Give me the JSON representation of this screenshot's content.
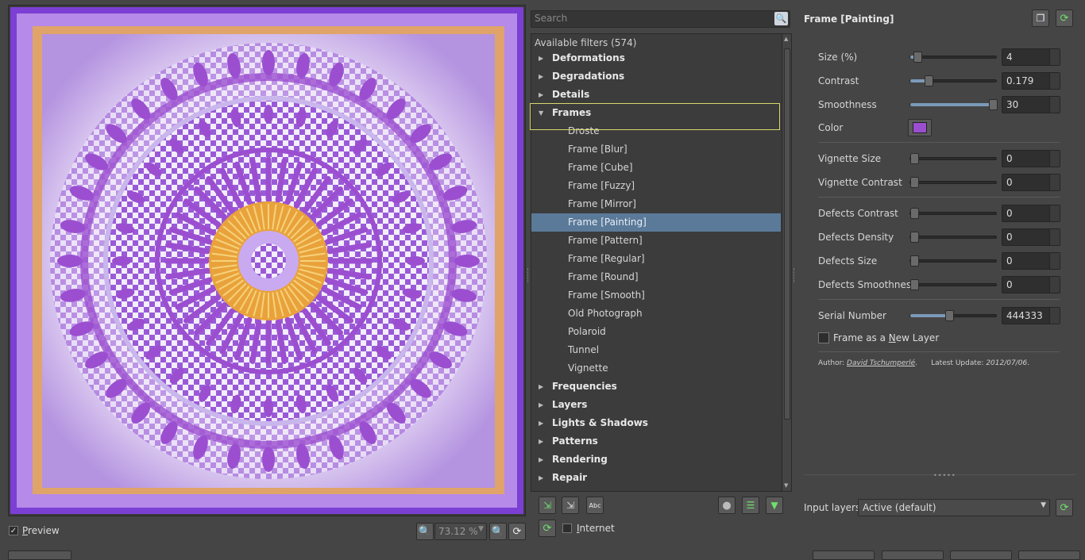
{
  "preview": {
    "checkbox_mark": "✓",
    "label_underline": "P",
    "label_rest": "review",
    "zoom": "73.12 %"
  },
  "search": {
    "placeholder": "Search"
  },
  "filters": {
    "header": "Available filters (574)",
    "categories_top": [
      "Deformations",
      "Degradations",
      "Details"
    ],
    "open_category": "Frames",
    "frames": [
      "Droste",
      "Frame [Blur]",
      "Frame [Cube]",
      "Frame [Fuzzy]",
      "Frame [Mirror]",
      "Frame [Painting]",
      "Frame [Pattern]",
      "Frame [Regular]",
      "Frame [Round]",
      "Frame [Smooth]",
      "Old Photograph",
      "Polaroid",
      "Tunnel",
      "Vignette"
    ],
    "selected": "Frame [Painting]",
    "categories_bottom": [
      "Frequencies",
      "Layers",
      "Lights & Shadows",
      "Patterns",
      "Rendering",
      "Repair"
    ]
  },
  "internet": {
    "label_underline": "I",
    "label_rest": "nternet"
  },
  "params": {
    "title": "Frame [Painting]",
    "size_label": "Size (%)",
    "size_value": "4",
    "size_level": 0.04,
    "contrast_label": "Contrast",
    "contrast_value": "0.179",
    "contrast_level": 0.18,
    "smoothness_label": "Smoothness",
    "smoothness_value": "30",
    "smoothness_level": 1.0,
    "color_label": "Color",
    "color_value": "#9b4fd0",
    "vignette_size_label": "Vignette Size",
    "vignette_size_value": "0",
    "vignette_contrast_label": "Vignette Contrast",
    "vignette_contrast_value": "0",
    "defects_contrast_label": "Defects Contrast",
    "defects_contrast_value": "0",
    "defects_density_label": "Defects Density",
    "defects_density_value": "0",
    "defects_size_label": "Defects Size",
    "defects_size_value": "0",
    "defects_smoothness_label": "Defects Smoothness",
    "defects_smoothness_value": "0",
    "serial_label": "Serial Number",
    "serial_value": "444333",
    "serial_level": 0.44,
    "new_layer_pre": "Frame as a ",
    "new_layer_u": "N",
    "new_layer_post": "ew Layer",
    "author_prefix": "Author: ",
    "author_name": "David Tschumperlé",
    "update_prefix": ".      Latest Update: ",
    "update_date": "2012/07/06",
    "update_suffix": "."
  },
  "input_layers": {
    "label": "Input layers",
    "value": "Active (default)"
  },
  "colors": {
    "accent": "#5b7a99",
    "purple": "#9b4fd0",
    "orange": "#e9a23b",
    "green": "#5fd15a"
  }
}
